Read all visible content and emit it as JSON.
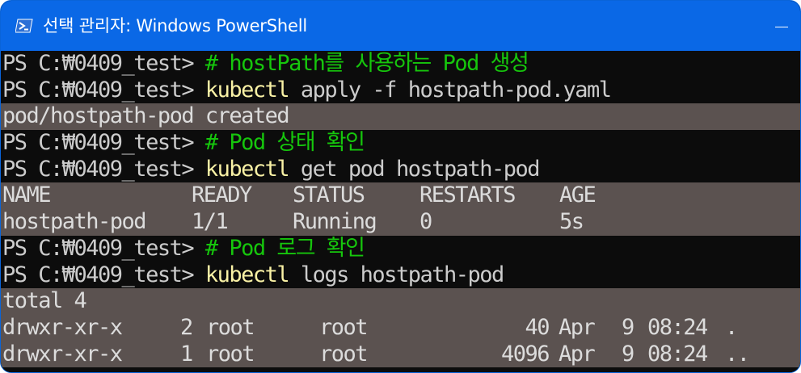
{
  "window": {
    "title": "선택 관리자: Windows PowerShell"
  },
  "console": {
    "prompt": "PS C:₩0409_test> ",
    "lines": {
      "l1": {
        "comment": "# hostPath를 사용하는 Pod 생성"
      },
      "l2": {
        "cmd": "kubectl",
        "args": " apply -f hostpath-pod.yaml"
      },
      "l3": {
        "text": "pod/hostpath-pod created"
      },
      "l4": {
        "comment": "# Pod 상태 확인"
      },
      "l5": {
        "cmd": "kubectl",
        "args": " get pod hostpath-pod"
      },
      "l8": {
        "comment": "# Pod 로그 확인"
      },
      "l9": {
        "cmd": "kubectl",
        "args": " logs hostpath-pod"
      },
      "l10": {
        "text": "total 4"
      }
    },
    "pod_table": {
      "headers": [
        "NAME",
        "READY",
        "STATUS",
        "RESTARTS",
        "AGE"
      ],
      "row": [
        "hostpath-pod",
        "1/1",
        "Running",
        "0",
        "5s"
      ]
    },
    "ls_rows": [
      {
        "perms": "drwxr-xr-x",
        "links": "2",
        "owner": "root",
        "group": "root",
        "size": "40",
        "month": "Apr",
        "day": "9",
        "time": "08:24",
        "name": "."
      },
      {
        "perms": "drwxr-xr-x",
        "links": "1",
        "owner": "root",
        "group": "root",
        "size": "4096",
        "month": "Apr",
        "day": "9",
        "time": "08:24",
        "name": ".."
      }
    ]
  }
}
